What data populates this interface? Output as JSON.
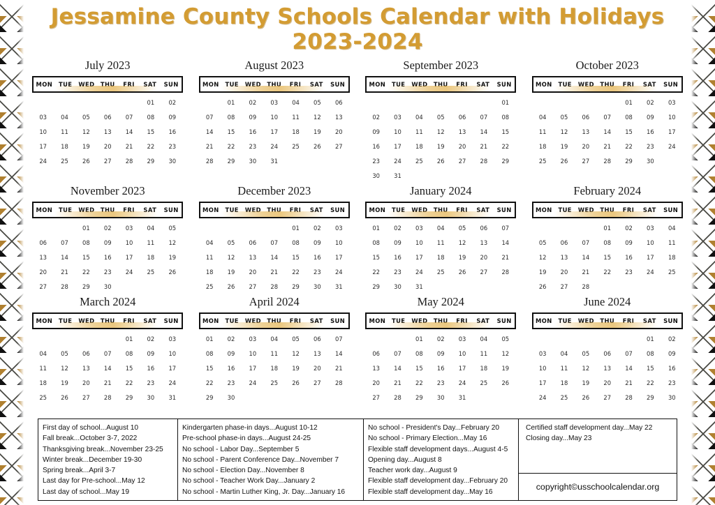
{
  "title": {
    "line1": "Jessamine County Schools Calendar with Holidays",
    "line2": "2023-2024",
    "color": "#d39c33"
  },
  "weekdays": [
    "MON",
    "TUE",
    "WED",
    "THU",
    "FRI",
    "SAT",
    "SUN"
  ],
  "months": [
    {
      "name": "July 2023",
      "weeks": [
        [
          "",
          "",
          "",
          "",
          "",
          "01",
          "02"
        ],
        [
          "03",
          "04",
          "05",
          "06",
          "07",
          "08",
          "09"
        ],
        [
          "10",
          "11",
          "12",
          "13",
          "14",
          "15",
          "16"
        ],
        [
          "17",
          "18",
          "19",
          "20",
          "21",
          "22",
          "23"
        ],
        [
          "24",
          "25",
          "26",
          "27",
          "28",
          "29",
          "30"
        ]
      ]
    },
    {
      "name": "August 2023",
      "weeks": [
        [
          "",
          "01",
          "02",
          "03",
          "04",
          "05",
          "06"
        ],
        [
          "07",
          "08",
          "09",
          "10",
          "11",
          "12",
          "13"
        ],
        [
          "14",
          "15",
          "16",
          "17",
          "18",
          "19",
          "20"
        ],
        [
          "21",
          "22",
          "23",
          "24",
          "25",
          "26",
          "27"
        ],
        [
          "28",
          "29",
          "30",
          "31",
          "",
          "",
          ""
        ]
      ]
    },
    {
      "name": "September 2023",
      "weeks": [
        [
          "",
          "",
          "",
          "",
          "",
          "",
          "01"
        ],
        [
          "02",
          "03",
          "04",
          "05",
          "06",
          "07",
          "08"
        ],
        [
          "09",
          "10",
          "11",
          "12",
          "13",
          "14",
          "15"
        ],
        [
          "16",
          "17",
          "18",
          "19",
          "20",
          "21",
          "22"
        ],
        [
          "23",
          "24",
          "25",
          "26",
          "27",
          "28",
          "29"
        ],
        [
          "30",
          "31",
          "",
          "",
          "",
          "",
          ""
        ]
      ]
    },
    {
      "name": "October 2023",
      "weeks": [
        [
          "",
          "",
          "",
          "",
          "01",
          "02",
          "03"
        ],
        [
          "04",
          "05",
          "06",
          "07",
          "08",
          "09",
          "10"
        ],
        [
          "11",
          "12",
          "13",
          "14",
          "15",
          "16",
          "17"
        ],
        [
          "18",
          "19",
          "20",
          "21",
          "22",
          "23",
          "24"
        ],
        [
          "25",
          "26",
          "27",
          "28",
          "29",
          "30",
          ""
        ]
      ]
    },
    {
      "name": "November 2023",
      "weeks": [
        [
          "",
          "",
          "01",
          "02",
          "03",
          "04",
          "05"
        ],
        [
          "06",
          "07",
          "08",
          "09",
          "10",
          "11",
          "12"
        ],
        [
          "13",
          "14",
          "15",
          "16",
          "17",
          "18",
          "19"
        ],
        [
          "20",
          "21",
          "22",
          "23",
          "24",
          "25",
          "26"
        ],
        [
          "27",
          "28",
          "29",
          "30",
          "",
          "",
          ""
        ]
      ]
    },
    {
      "name": "December 2023",
      "weeks": [
        [
          "",
          "",
          "",
          "",
          "01",
          "02",
          "03"
        ],
        [
          "04",
          "05",
          "06",
          "07",
          "08",
          "09",
          "10"
        ],
        [
          "11",
          "12",
          "13",
          "14",
          "15",
          "16",
          "17"
        ],
        [
          "18",
          "19",
          "20",
          "21",
          "22",
          "23",
          "24"
        ],
        [
          "25",
          "26",
          "27",
          "28",
          "29",
          "30",
          "31"
        ]
      ]
    },
    {
      "name": "January 2024",
      "weeks": [
        [
          "01",
          "02",
          "03",
          "04",
          "05",
          "06",
          "07"
        ],
        [
          "08",
          "09",
          "10",
          "11",
          "12",
          "13",
          "14"
        ],
        [
          "15",
          "16",
          "17",
          "18",
          "19",
          "20",
          "21"
        ],
        [
          "22",
          "23",
          "24",
          "25",
          "26",
          "27",
          "28"
        ],
        [
          "29",
          "30",
          "31",
          "",
          "",
          "",
          ""
        ]
      ]
    },
    {
      "name": "February 2024",
      "weeks": [
        [
          "",
          "",
          "",
          "01",
          "02",
          "03",
          "04"
        ],
        [
          "05",
          "06",
          "07",
          "08",
          "09",
          "10",
          "11"
        ],
        [
          "12",
          "13",
          "14",
          "15",
          "16",
          "17",
          "18"
        ],
        [
          "19",
          "20",
          "21",
          "22",
          "23",
          "24",
          "25"
        ],
        [
          "26",
          "27",
          "28",
          "",
          "",
          "",
          ""
        ]
      ]
    },
    {
      "name": "March 2024",
      "weeks": [
        [
          "",
          "",
          "",
          "",
          "01",
          "02",
          "03"
        ],
        [
          "04",
          "05",
          "06",
          "07",
          "08",
          "09",
          "10"
        ],
        [
          "11",
          "12",
          "13",
          "14",
          "15",
          "16",
          "17"
        ],
        [
          "18",
          "19",
          "20",
          "21",
          "22",
          "23",
          "24"
        ],
        [
          "25",
          "26",
          "27",
          "28",
          "29",
          "30",
          "31"
        ]
      ]
    },
    {
      "name": "April 2024",
      "weeks": [
        [
          "01",
          "02",
          "03",
          "04",
          "05",
          "06",
          "07"
        ],
        [
          "08",
          "09",
          "10",
          "11",
          "12",
          "13",
          "14"
        ],
        [
          "15",
          "16",
          "17",
          "18",
          "19",
          "20",
          "21"
        ],
        [
          "22",
          "23",
          "24",
          "25",
          "26",
          "27",
          "28"
        ],
        [
          "29",
          "30",
          "",
          "",
          "",
          "",
          ""
        ]
      ]
    },
    {
      "name": "May 2024",
      "weeks": [
        [
          "",
          "",
          "01",
          "02",
          "03",
          "04",
          "05"
        ],
        [
          "06",
          "07",
          "08",
          "09",
          "10",
          "11",
          "12"
        ],
        [
          "13",
          "14",
          "15",
          "16",
          "17",
          "18",
          "19"
        ],
        [
          "20",
          "21",
          "22",
          "23",
          "24",
          "25",
          "26"
        ],
        [
          "27",
          "28",
          "29",
          "30",
          "31",
          "",
          ""
        ]
      ]
    },
    {
      "name": "June 2024",
      "weeks": [
        [
          "",
          "",
          "",
          "",
          "",
          "01",
          "02"
        ],
        [
          "03",
          "04",
          "05",
          "06",
          "07",
          "08",
          "09"
        ],
        [
          "10",
          "11",
          "12",
          "13",
          "14",
          "15",
          "16"
        ],
        [
          "17",
          "18",
          "19",
          "20",
          "21",
          "22",
          "23"
        ],
        [
          "24",
          "25",
          "26",
          "27",
          "28",
          "29",
          "30"
        ]
      ]
    }
  ],
  "legend": {
    "column1": [
      "First day of school...August 10",
      "Fall break...October 3-7, 2022",
      "Thanksgiving break...November 23-25",
      "Winter break...December 19-30",
      "Spring break...April 3-7",
      "Last day for Pre-school...May 12",
      "Last day of school...May 19"
    ],
    "column2": [
      "Kindergarten phase-in days...August 10-12",
      "Pre-school phase-in days...August 24-25",
      "No school - Labor Day...September 5",
      "No school - Parent Conference Day...November 7",
      "No school - Election Day...November 8",
      "No school - Teacher Work Day...January 2",
      "No school - Martin Luther King, Jr. Day...January 16"
    ],
    "column3": [
      "No school - President's Day...February 20",
      "No school - Primary Election...May 16",
      "Flexible staff development days...August 4-5",
      "Opening day...August 8",
      "Teacher work day...August 9",
      "Flexible staff development day...February 20",
      "Flexible staff development day...May 16"
    ],
    "column4": [
      "Certified staff development day...May 22",
      "Closing day...May 23"
    ],
    "copyright": "copyright©usschoolcalendar.org"
  }
}
